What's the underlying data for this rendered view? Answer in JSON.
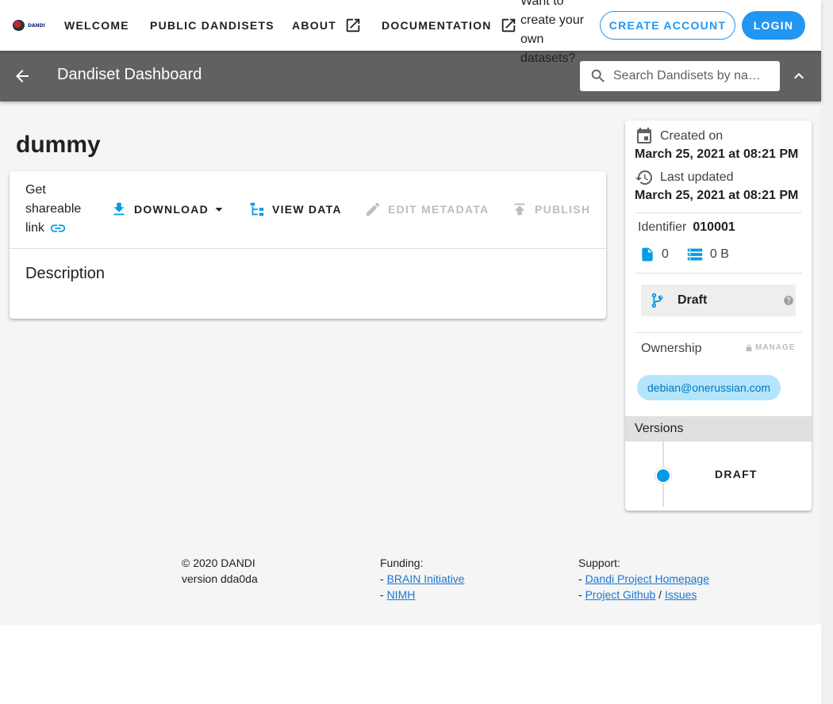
{
  "nav": {
    "logo_text": "DANDI",
    "items": [
      {
        "label": "WELCOME"
      },
      {
        "label": "PUBLIC DANDISETS"
      },
      {
        "label": "ABOUT"
      },
      {
        "label": "DOCUMENTATION"
      }
    ],
    "prompt_text": "Want to create your own datasets?",
    "create_account": "CREATE ACCOUNT",
    "login": "LOGIN"
  },
  "toolbar": {
    "title": "Dandiset Dashboard",
    "search_placeholder": "Search Dandisets by na…"
  },
  "dandiset": {
    "name": "dummy",
    "share_label": "Get shareable link",
    "actions": {
      "download": "DOWNLOAD",
      "view_data": "VIEW DATA",
      "edit_metadata": "EDIT METADATA",
      "publish": "PUBLISH"
    },
    "description_label": "Description"
  },
  "meta": {
    "created_label": "Created on",
    "created_value": "March 25, 2021 at 08:21 PM",
    "updated_label": "Last updated",
    "updated_value": "March 25, 2021 at 08:21 PM",
    "identifier_label": "Identifier",
    "identifier_value": "010001",
    "file_count": "0",
    "size": "0 B",
    "version_status": "Draft",
    "ownership_label": "Ownership",
    "manage_label": "MANAGE",
    "owner_email": "debian@onerussian.com",
    "versions_label": "Versions",
    "versions": [
      {
        "label": "DRAFT"
      }
    ]
  },
  "footer": {
    "copyright": "© 2020 DANDI",
    "version": "version dda0da",
    "funding_label": "Funding:",
    "funding_links": [
      "BRAIN Initiative",
      "NIMH"
    ],
    "support_label": "Support:",
    "support_homepage": "Dandi Project Homepage",
    "support_github": "Project Github",
    "support_sep": "/",
    "support_issues": "Issues"
  },
  "colors": {
    "primary": "#2196f3",
    "toolbar_bg": "#616161",
    "accent_icon": "#039be5",
    "chip_bg": "#b3e5fc"
  }
}
